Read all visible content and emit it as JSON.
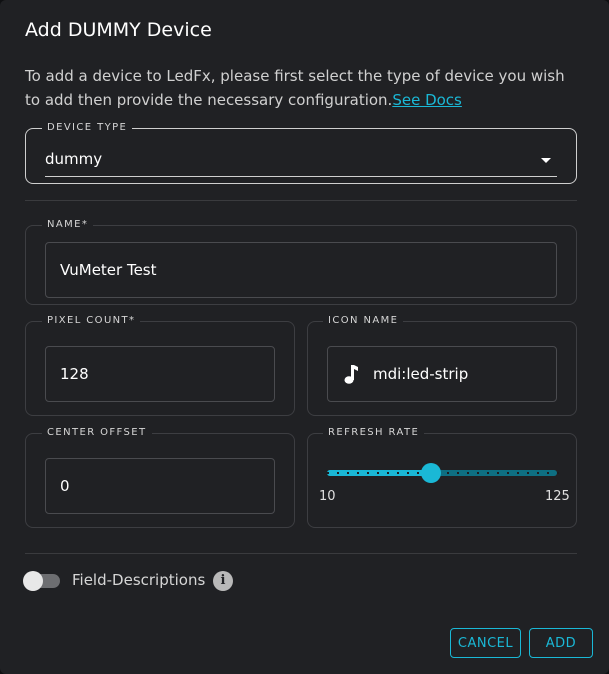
{
  "dialog": {
    "title": "Add DUMMY Device",
    "description": "To add a device to LedFx, please first select the type of device you wish to add then provide the necessary configuration.",
    "docs_link": "See Docs"
  },
  "device_type": {
    "label": "DEVICE TYPE",
    "value": "dummy"
  },
  "fields": {
    "name": {
      "label": "NAME*",
      "value": "VuMeter Test"
    },
    "pixel_count": {
      "label": "PIXEL COUNT*",
      "value": "128"
    },
    "icon_name": {
      "label": "ICON NAME",
      "value": "mdi:led-strip",
      "icon": "music-note-icon"
    },
    "center_offset": {
      "label": "CENTER OFFSET",
      "value": "0"
    },
    "refresh_rate": {
      "label": "REFRESH RATE",
      "min": "10",
      "max": "125",
      "value": 62
    }
  },
  "toggle": {
    "label": "Field-Descriptions",
    "on": false,
    "info_icon": "i"
  },
  "buttons": {
    "cancel": "CANCEL",
    "add": "ADD"
  },
  "colors": {
    "accent": "#1ab8d6",
    "background": "#202124"
  }
}
